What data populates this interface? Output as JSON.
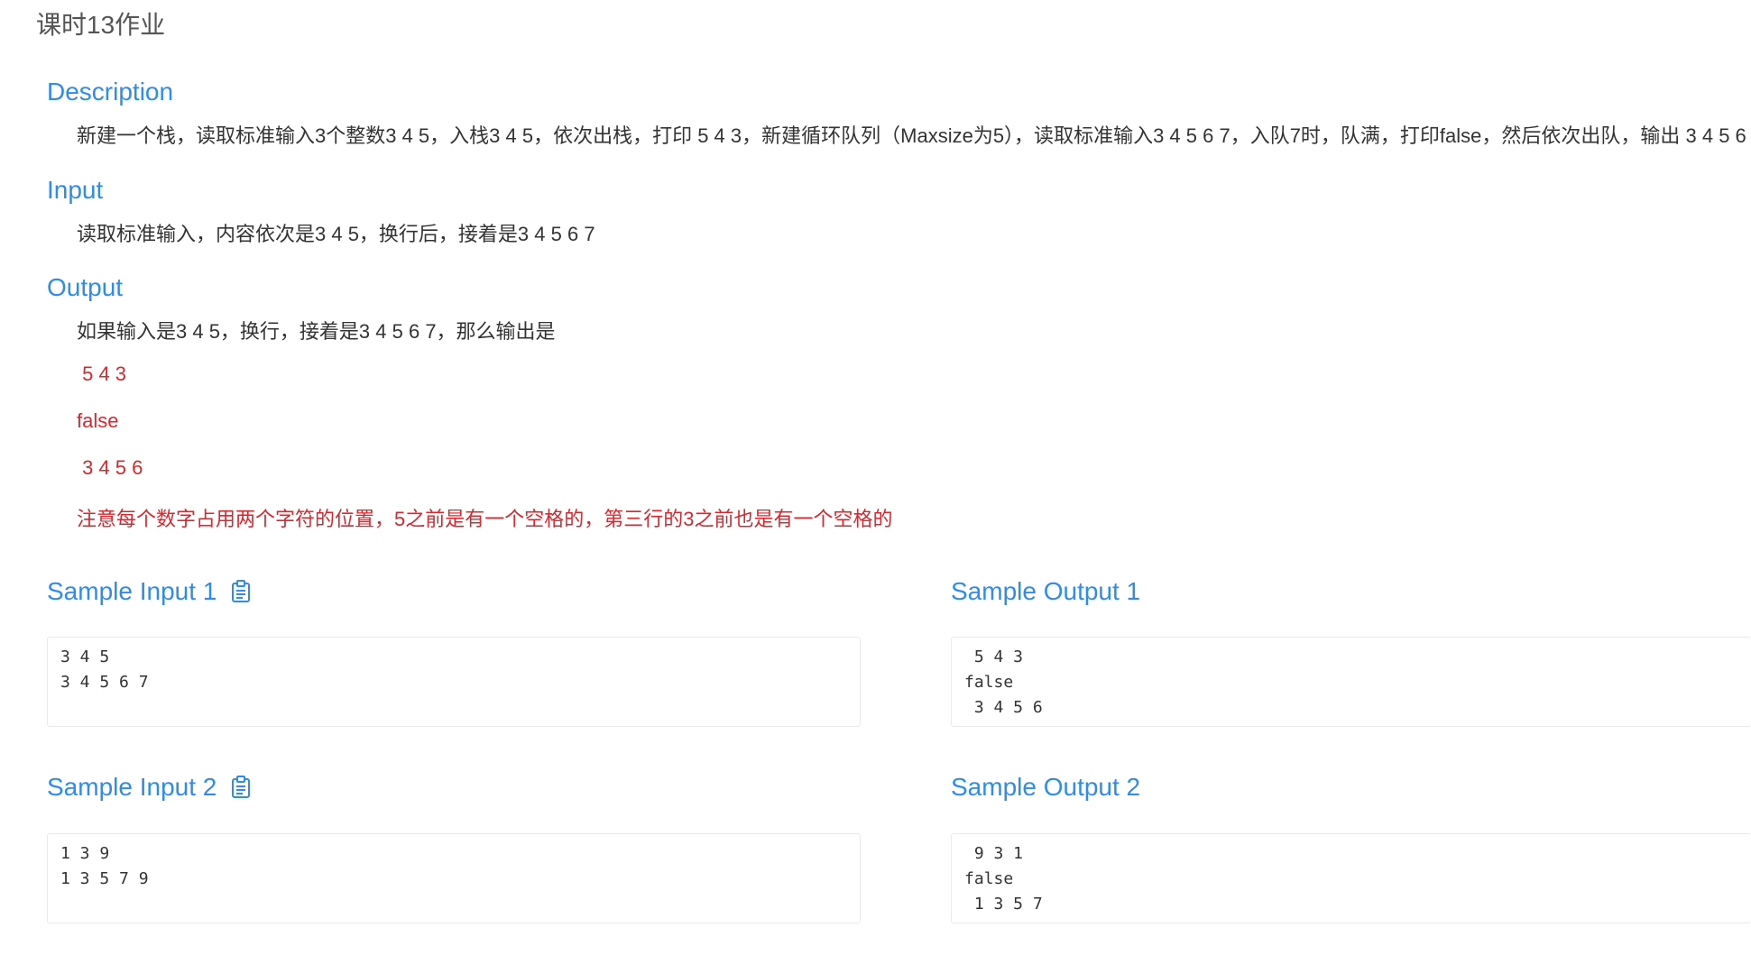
{
  "page": {
    "title": "课时13作业"
  },
  "sections": {
    "description": {
      "title": "Description",
      "text": "新建一个栈，读取标准输入3个整数3 4 5，入栈3 4 5，依次出栈，打印 5 4 3，新建循环队列（Maxsize为5），读取标准输入3 4 5 6 7，入队7时，队满，打印false，然后依次出队，输出 3 4 5 6"
    },
    "input": {
      "title": "Input",
      "text": "读取标准输入，内容依次是3 4 5，换行后，接着是3 4 5 6 7"
    },
    "output": {
      "title": "Output",
      "text": "如果输入是3 4 5，换行，接着是3 4 5 6 7，那么输出是",
      "line1": " 5 4 3",
      "line2": "false",
      "line3": " 3 4 5 6",
      "note": "注意每个数字占用两个字符的位置，5之前是有一个空格的，第三行的3之前也是有一个空格的"
    }
  },
  "samples": [
    {
      "input_title": "Sample Input 1",
      "input_text": "3 4 5\n3 4 5 6 7",
      "output_title": "Sample Output 1",
      "output_text": " 5 4 3\nfalse\n 3 4 5 6"
    },
    {
      "input_title": "Sample Input 2",
      "input_text": "1 3 9\n1 3 5 7 9",
      "output_title": "Sample Output 2",
      "output_text": " 9 3 1\nfalse\n 1 3 5 7"
    }
  ],
  "icons": {
    "copy": "clipboard-icon"
  },
  "colors": {
    "accent": "#2d8cf0",
    "note_red": "#d9272d",
    "text": "#333333",
    "border": "#e8eaec"
  }
}
